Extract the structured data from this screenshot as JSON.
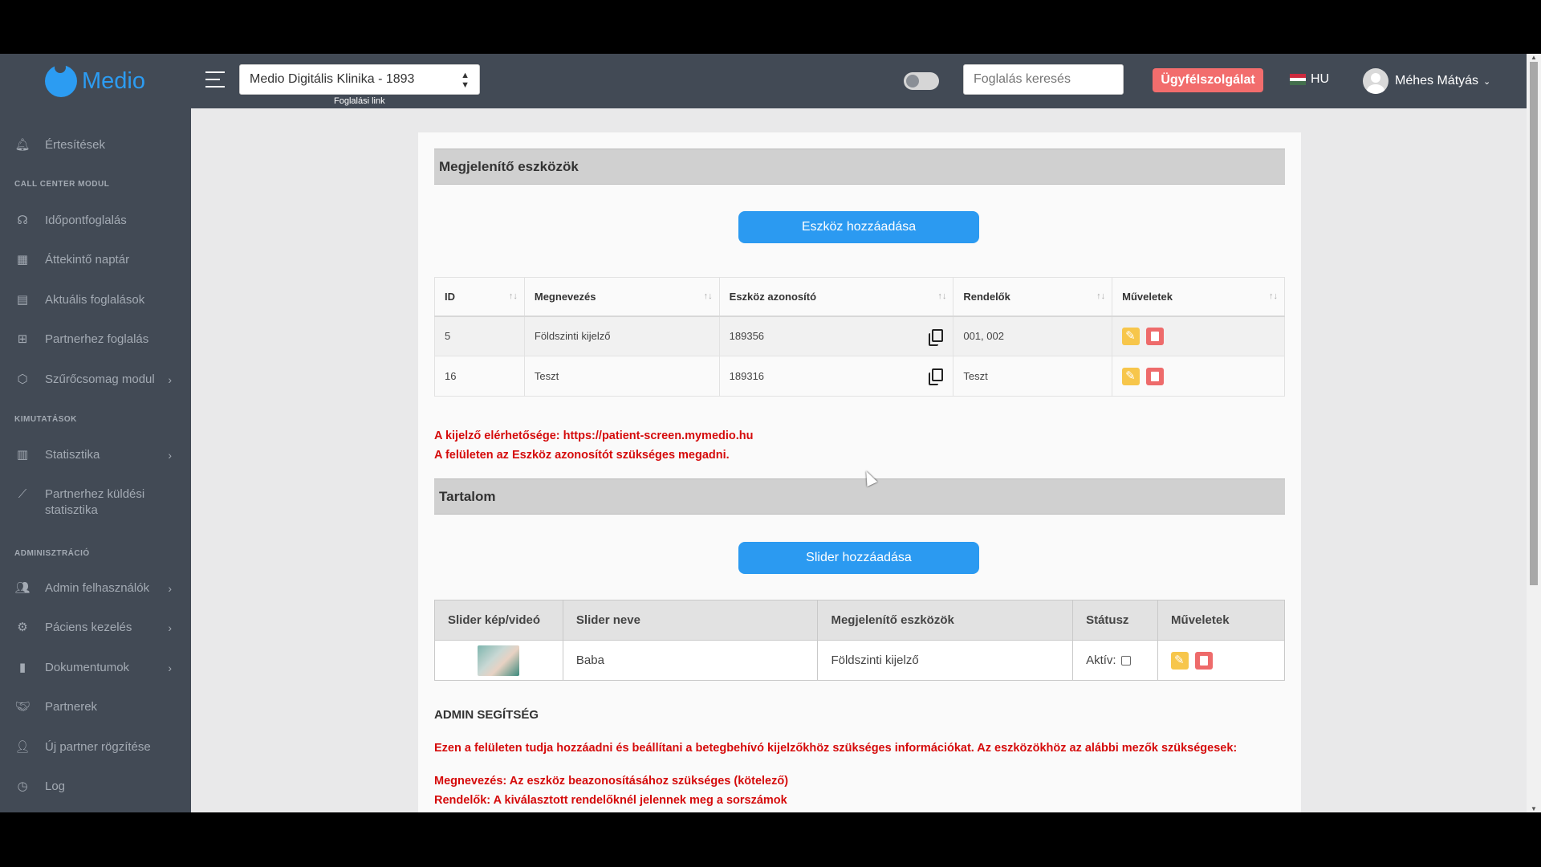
{
  "header": {
    "logo_text": "Medio",
    "clinic_select_value": "Medio Digitális Klinika - 1893",
    "booking_link": "Foglalási link",
    "search_placeholder": "Foglalás keresés",
    "support_button": "Ügyfélszolgálat",
    "language": "HU",
    "user_name": "Méhes Mátyás"
  },
  "sidebar": {
    "items": [
      {
        "label": "Értesítések",
        "icon": "bell-icon"
      },
      {
        "label": "Időpontfoglalás",
        "icon": "headset-icon"
      },
      {
        "label": "Áttekintő naptár",
        "icon": "grid-calendar-icon"
      },
      {
        "label": "Aktuális foglalások",
        "icon": "calendar-icon"
      },
      {
        "label": "Partnerhez foglalás",
        "icon": "calendar-plus-icon"
      },
      {
        "label": "Szűrőcsomag modul",
        "icon": "cube-icon"
      },
      {
        "label": "Statisztika",
        "icon": "bar-chart-icon"
      },
      {
        "label": "Partnerhez küldési statisztika",
        "icon": "line-chart-icon"
      },
      {
        "label": "Admin felhasználók",
        "icon": "users-icon"
      },
      {
        "label": "Páciens kezelés",
        "icon": "user-cog-icon"
      },
      {
        "label": "Dokumentumok",
        "icon": "document-icon"
      },
      {
        "label": "Partnerek",
        "icon": "handshake-icon"
      },
      {
        "label": "Új partner rögzítése",
        "icon": "user-plus-icon"
      },
      {
        "label": "Log",
        "icon": "clock-icon"
      }
    ],
    "headings": [
      "CALL CENTER MODUL",
      "KIMUTATÁSOK",
      "ADMINISZTRÁCIÓ"
    ]
  },
  "devices": {
    "title": "Megjelenítő eszközök",
    "add_button": "Eszköz hozzáadása",
    "columns": [
      "ID",
      "Megnevezés",
      "Eszköz azonosító",
      "Rendelők",
      "Műveletek"
    ],
    "rows": [
      {
        "id": "5",
        "name": "Földszinti kijelző",
        "device_id": "189356",
        "offices": "001, 002"
      },
      {
        "id": "16",
        "name": "Teszt",
        "device_id": "189316",
        "offices": "Teszt"
      }
    ],
    "note_line1": "A kijelző elérhetősége: https://patient-screen.mymedio.hu",
    "note_line2": "A felületen az Eszköz azonosítót szükséges megadni."
  },
  "content": {
    "title": "Tartalom",
    "add_button": "Slider hozzáadása",
    "columns": [
      "Slider kép/videó",
      "Slider neve",
      "Megjelenítő eszközök",
      "Státusz",
      "Műveletek"
    ],
    "rows": [
      {
        "name": "Baba",
        "devices": "Földszinti kijelző",
        "status_label": "Aktív:"
      }
    ]
  },
  "help": {
    "title": "ADMIN SEGÍTSÉG",
    "intro": "Ezen a felületen tudja hozzáadni és beállítani a betegbehívó kijelzőkhöz szükséges információkat. Az eszközökhöz az alábbi mezők szükségesek:",
    "line1": "Megnevezés: Az eszköz beazonosításához szükséges (kötelező)",
    "line2": "Rendelők: A kiválasztott rendelőknél jelennek meg a sorszámok"
  },
  "colors": {
    "sidebar_bg": "#424a55",
    "brand_blue": "#2b9af1",
    "support_red": "#f26d6d",
    "help_red": "#d50b0b"
  }
}
